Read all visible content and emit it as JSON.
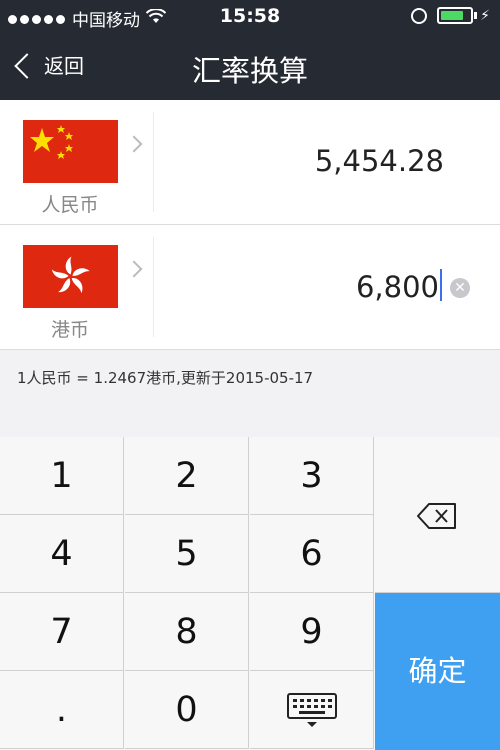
{
  "status": {
    "carrier": "中国移动",
    "time": "15:58",
    "battery_level": 0.8,
    "signal_icon": "signal-dots-icon",
    "wifi_icon": "wifi-icon"
  },
  "nav": {
    "back_label": "返回",
    "title": "汇率换算"
  },
  "rows": [
    {
      "currency": "人民币",
      "amount": "5,454.28",
      "flag_icon": "cn-flag-icon"
    },
    {
      "currency": "港币",
      "amount": "6,800",
      "flag_icon": "hk-flag-icon"
    }
  ],
  "rate_info": "1人民币 = 1.2467港币,更新于2015-05-17",
  "keypad": {
    "keys": [
      "1",
      "2",
      "3",
      "4",
      "5",
      "6",
      "7",
      "8",
      "9",
      ".",
      "0"
    ],
    "delete_icon": "backspace-icon",
    "confirm_label": "确定",
    "keyboard_icon": "keyboard-hide-icon"
  },
  "colors": {
    "nav_bg": "#262b33",
    "confirm": "#3f9ff0",
    "china_red": "#de2910",
    "hk_red": "#de2910",
    "battery_green": "#4cd964"
  }
}
